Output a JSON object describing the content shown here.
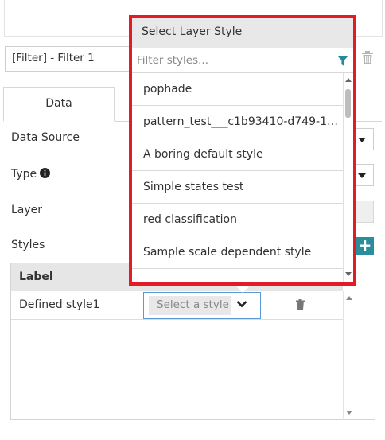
{
  "filter": {
    "selected": "[Filter] - Filter 1"
  },
  "tabs": [
    {
      "label": "Data"
    }
  ],
  "form": {
    "data_source_label": "Data Source",
    "type_label": "Type",
    "layer_label": "Layer",
    "styles_label": "Styles"
  },
  "styles_table": {
    "header": "Label",
    "rows": [
      {
        "label": "Defined style1",
        "select_placeholder": "Select a style"
      }
    ]
  },
  "popup": {
    "title": "Select Layer Style",
    "filter_placeholder": "Filter styles...",
    "items": [
      "pophade",
      "pattern_test___c1b93410-d749-11f...",
      "A boring default style",
      "Simple states test",
      "red classification",
      "Sample scale dependent style"
    ]
  },
  "colors": {
    "highlight_border": "#e21b25",
    "accent_teal": "#2a8d9c",
    "select_focus_border": "#5b9bd5"
  }
}
